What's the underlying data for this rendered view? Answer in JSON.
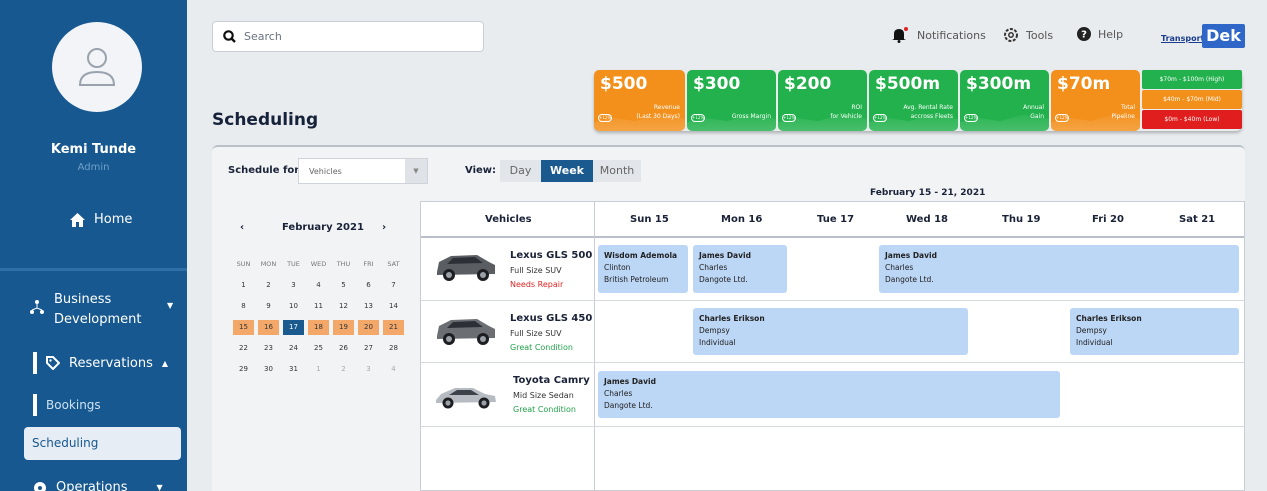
{
  "sidebar": {
    "user_name": "Kemi Tunde",
    "user_role": "Admin",
    "home_label": "Home",
    "bd_line1": "Business",
    "bd_line2": "Development",
    "reservations_label": "Reservations",
    "bookings_label": "Bookings",
    "scheduling_label": "Scheduling",
    "operations_label": "Operations"
  },
  "topbar": {
    "search_placeholder": "Search",
    "notifications": "Notifications",
    "tools": "Tools",
    "help": "Help",
    "logo_left": "Transport",
    "logo_right": "Dek"
  },
  "page_title": "Scheduling",
  "kpis": [
    {
      "value": "$500",
      "label1": "Revenue",
      "label2": "(Last 30 Days)",
      "color": "orange"
    },
    {
      "value": "$300",
      "label1": "",
      "label2": "Gross Margin",
      "color": "green"
    },
    {
      "value": "$200",
      "label1": "ROI",
      "label2": "for Vehicle",
      "color": "green"
    },
    {
      "value": "$500m",
      "label1": "Avg. Rental Rate",
      "label2": "accross Fleets",
      "color": "green"
    },
    {
      "value": "$300m",
      "label1": "Annual",
      "label2": "Gain",
      "color": "green"
    },
    {
      "value": "$70m",
      "label1": "Total",
      "label2": "Pipeline",
      "color": "orange"
    }
  ],
  "ranges": [
    {
      "label": "$70m - $100m (High)",
      "color": "#22b14c"
    },
    {
      "label": "$40m - $70m (Mid)",
      "color": "#f3901c"
    },
    {
      "label": "$0m - $40m (Low)",
      "color": "#e01e1e"
    }
  ],
  "controls": {
    "schedule_for_label": "Schedule for",
    "schedule_for_value": "Vehicles",
    "view_label": "View:",
    "view_day": "Day",
    "view_week": "Week",
    "view_month": "Month",
    "week_range": "February 15 - 21, 2021"
  },
  "calendar": {
    "prev": "‹",
    "next": "›",
    "month": "February 2021",
    "dow": [
      "SUN",
      "MON",
      "TUE",
      "WED",
      "THU",
      "FRI",
      "SAT"
    ],
    "weeks": [
      [
        "1",
        "2",
        "3",
        "4",
        "5",
        "6",
        "7"
      ],
      [
        "8",
        "9",
        "10",
        "11",
        "12",
        "13",
        "14"
      ],
      [
        "15",
        "16",
        "17",
        "18",
        "19",
        "20",
        "21"
      ],
      [
        "22",
        "23",
        "24",
        "25",
        "26",
        "27",
        "28"
      ],
      [
        "29",
        "30",
        "31",
        "1",
        "2",
        "3",
        "4"
      ]
    ]
  },
  "table": {
    "vehicles_header": "Vehicles",
    "days": [
      "Sun 15",
      "Mon 16",
      "Tue 17",
      "Wed 18",
      "Thu 19",
      "Fri 20",
      "Sat 21"
    ],
    "vehicles": [
      {
        "name": "Lexus GLS 500",
        "type": "Full Size SUV",
        "condition": "Needs Repair",
        "cond_color": "#e02424"
      },
      {
        "name": "Lexus GLS 450",
        "type": "Full Size SUV",
        "condition": "Great Condition",
        "cond_color": "#22a34a"
      },
      {
        "name": "Toyota Camry",
        "type": "Mid Size Sedan",
        "condition": "Great Condition",
        "cond_color": "#22a34a"
      }
    ],
    "bookings": [
      {
        "name": "Wisdom Ademola",
        "l2": "Clinton",
        "l3": "British Petroleum"
      },
      {
        "name": "James David",
        "l2": "Charles",
        "l3": "Dangote Ltd."
      },
      {
        "name": "James David",
        "l2": "Charles",
        "l3": "Dangote Ltd."
      },
      {
        "name": "Charles Erikson",
        "l2": "Dempsy",
        "l3": "Individual"
      },
      {
        "name": "Charles Erikson",
        "l2": "Dempsy",
        "l3": "Individual"
      },
      {
        "name": "James David",
        "l2": "Charles",
        "l3": "Dangote Ltd."
      }
    ]
  }
}
